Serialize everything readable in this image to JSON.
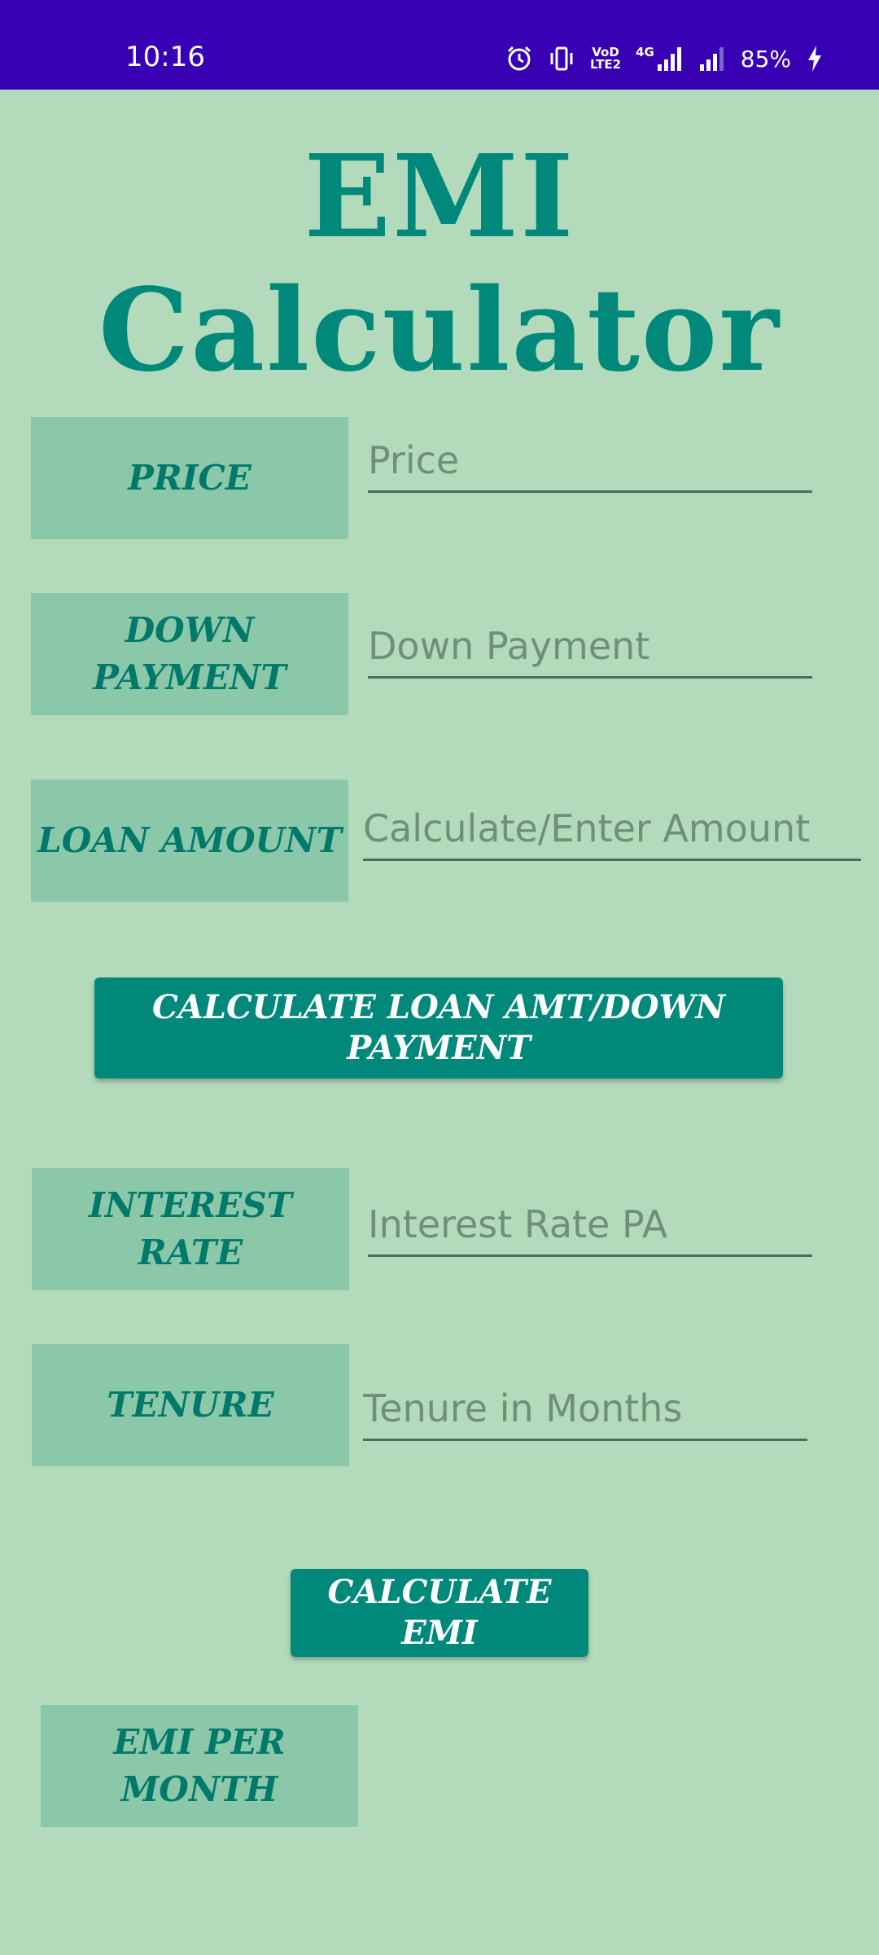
{
  "status_bar": {
    "time": "10:16",
    "volte_label": "VoD\nLTE2",
    "network_label": "4G",
    "battery": "85%",
    "icons": [
      "alarm-icon",
      "vibrate-icon",
      "volte-icon",
      "signal-4g-icon",
      "signal-icon",
      "battery-charging-icon"
    ]
  },
  "app": {
    "title": "EMI Calculator"
  },
  "fields": {
    "price": {
      "label": "PRICE",
      "placeholder": "Price"
    },
    "down_payment": {
      "label": "DOWN PAYMENT",
      "placeholder": "Down Payment"
    },
    "loan_amount": {
      "label": "LOAN AMOUNT",
      "placeholder": "Calculate/Enter Amount"
    },
    "interest_rate": {
      "label": "INTEREST RATE",
      "placeholder": "Interest Rate PA"
    },
    "tenure": {
      "label": "TENURE",
      "placeholder": "Tenure in Months"
    }
  },
  "buttons": {
    "calc_loan": "CALCULATE LOAN AMT/DOWN PAYMENT",
    "calc_emi": "CALCULATE EMI"
  },
  "result": {
    "label": "EMI PER MONTH"
  },
  "colors": {
    "background": "#b3dbbb",
    "status_bar": "#3700b3",
    "accent": "#00897b",
    "label_box": "#8ac8a9"
  }
}
